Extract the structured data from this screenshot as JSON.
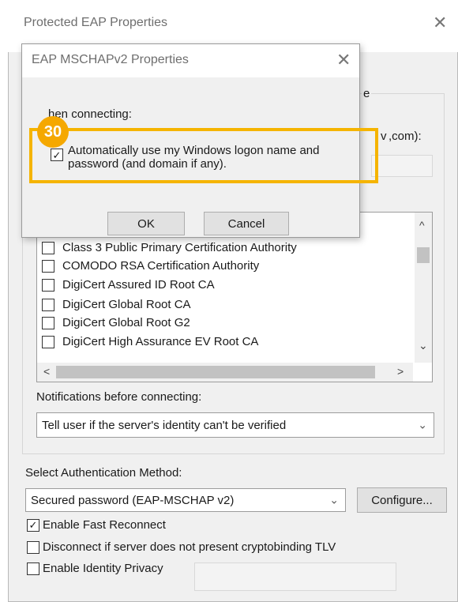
{
  "outer_dialog": {
    "title": "Protected EAP Properties",
    "close_glyph": "✕",
    "hidden_heading_fragment": "e",
    "server_label_fragment": "v",
    "server_label_end": ",com):",
    "cert_list": {
      "items": [
        {
          "label": "Class 3 Public Primary Certification Authority",
          "checked": false
        },
        {
          "label": "COMODO RSA Certification Authority",
          "checked": false
        },
        {
          "label": "DigiCert Assured ID Root CA",
          "checked": false
        },
        {
          "label": "DigiCert Global Root CA",
          "checked": false
        },
        {
          "label": "DigiCert Global Root G2",
          "checked": false
        },
        {
          "label": "DigiCert High Assurance EV Root CA",
          "checked": false
        }
      ],
      "scroll_up": "^",
      "scroll_down": "⌄",
      "scroll_left": "<",
      "scroll_right": ">"
    },
    "notifications_label": "Notifications before connecting:",
    "notifications_value": "Tell user if the server's identity can't be verified",
    "auth_method_label": "Select Authentication Method:",
    "auth_method_value": "Secured password (EAP-MSCHAP v2)",
    "configure_button": "Configure...",
    "checkboxes": [
      {
        "label": "Enable Fast Reconnect",
        "checked": true
      },
      {
        "label": "Disconnect if server does not present cryptobinding TLV",
        "checked": false
      },
      {
        "label": "Enable Identity Privacy",
        "checked": false
      }
    ],
    "chevron_glyph": "⌄"
  },
  "inner_dialog": {
    "title": "EAP MSCHAPv2 Properties",
    "close_glyph": "✕",
    "when_connecting_label": "hen connecting:",
    "auto_logon_label_line1": "Automatically use my Windows logon name and",
    "auto_logon_label_line2": "password (and domain if any).",
    "auto_logon_checked": true,
    "ok_button": "OK",
    "cancel_button": "Cancel"
  },
  "annotation": {
    "step_number": "30",
    "badge_color": "#f5a800",
    "highlight_color": "#f5b400"
  },
  "check_glyph": "✓"
}
